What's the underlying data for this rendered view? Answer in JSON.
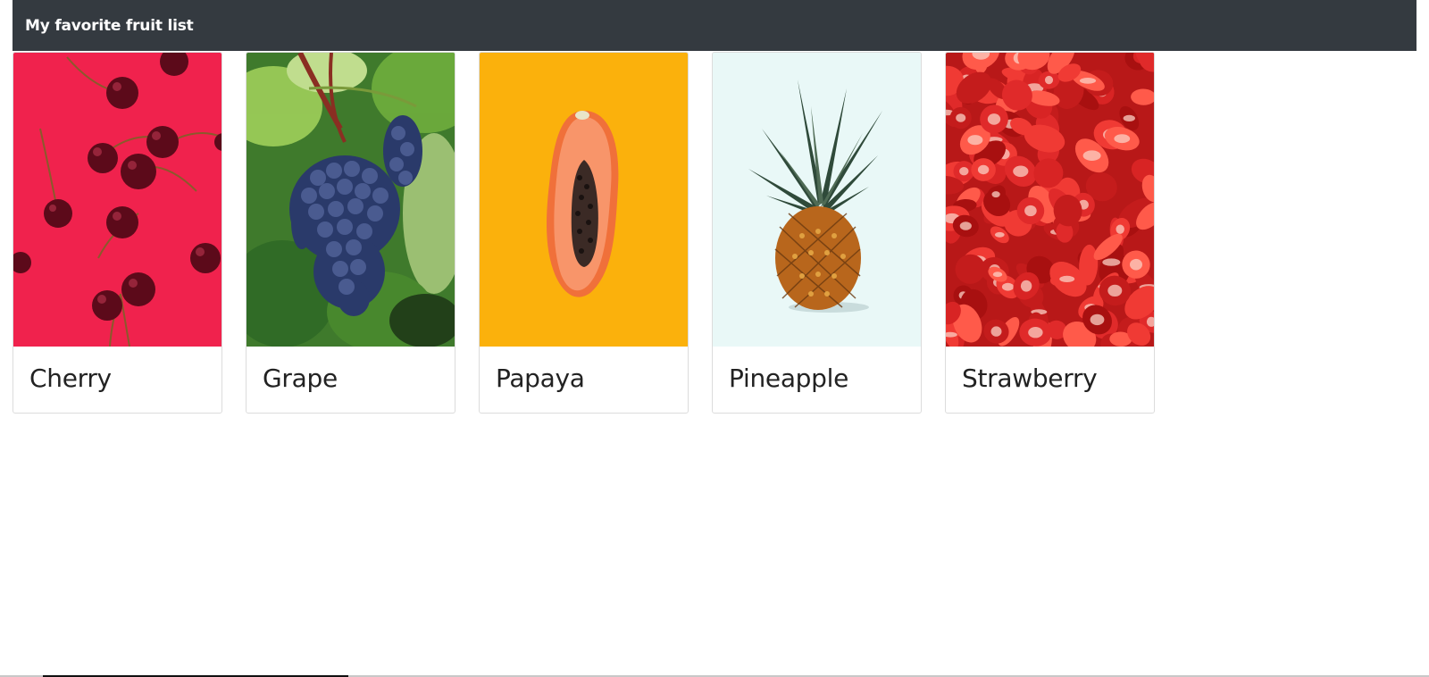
{
  "navbar": {
    "brand": "My favorite fruit list"
  },
  "cards": [
    {
      "title": "Cherry",
      "image_icon": "cherry-image",
      "background": "#f0224d"
    },
    {
      "title": "Grape",
      "image_icon": "grape-image",
      "background": "#3f7a2c"
    },
    {
      "title": "Papaya",
      "image_icon": "papaya-image",
      "background": "#fbb10c"
    },
    {
      "title": "Pineapple",
      "image_icon": "pineapple-image",
      "background": "#e9f8f7"
    },
    {
      "title": "Strawberry",
      "image_icon": "strawberry-image",
      "background": "#c91e1e"
    }
  ]
}
